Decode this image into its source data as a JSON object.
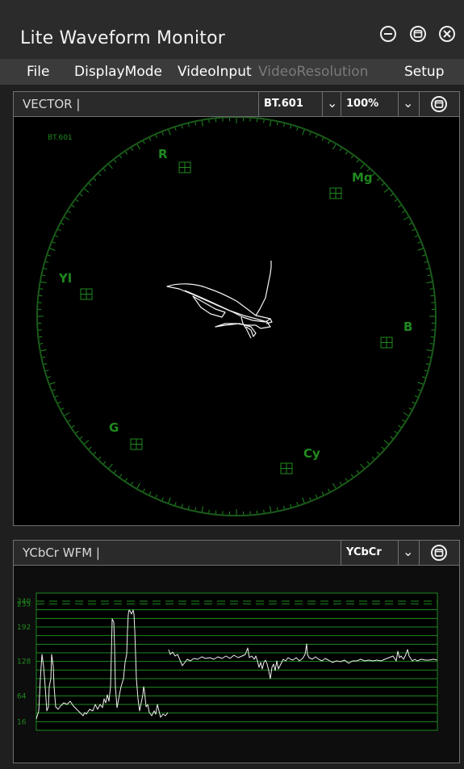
{
  "window": {
    "title": "Lite Waveform Monitor",
    "controls": [
      "minimize-icon",
      "maximize-icon",
      "close-icon"
    ]
  },
  "menu": {
    "file": "File",
    "display_mode": "DisplayMode",
    "video_input": "VideoInput",
    "video_resolution": "VideoResolution",
    "setup": "Setup"
  },
  "vector_panel": {
    "label": "VECTOR |",
    "standard": "BT.601",
    "zoom": "100%",
    "scope_standard_label": "BT.601",
    "targets": [
      "R",
      "Mg",
      "Yl",
      "B",
      "G",
      "Cy"
    ]
  },
  "wfm_panel": {
    "label": "YCbCr WFM |",
    "mode": "YCbCr",
    "scale_labels": [
      "240",
      "235",
      "192",
      "128",
      "64",
      "16"
    ]
  },
  "colors": {
    "scope_green": "#1f8a1f",
    "trace": "#ffffff",
    "disabled_text": "#7a7a7a"
  }
}
